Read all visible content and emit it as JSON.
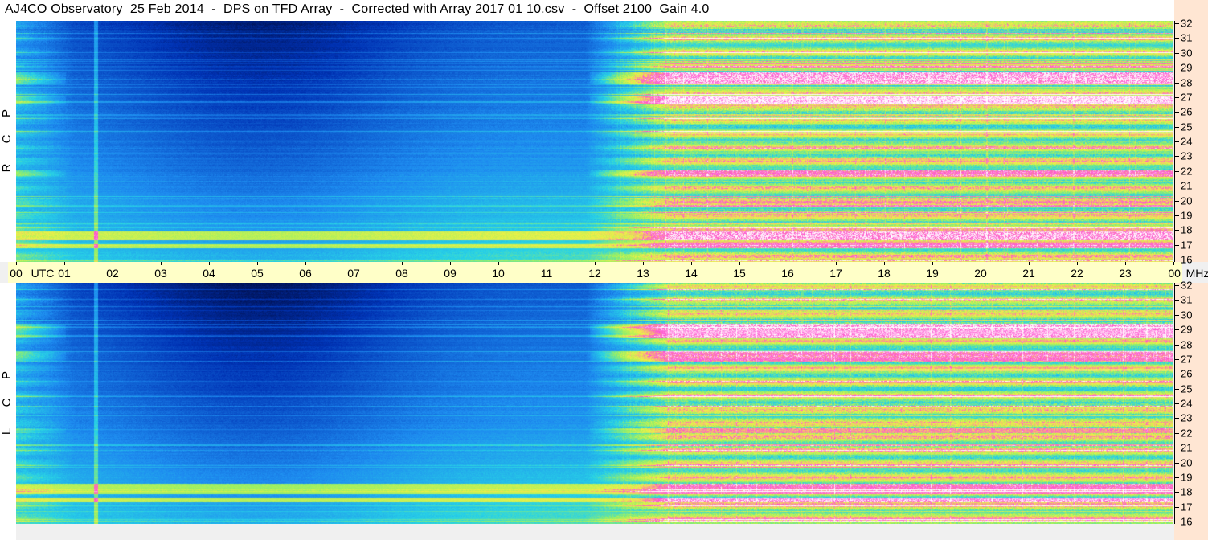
{
  "title": "AJ4CO Observatory  25 Feb 2014  -  DPS on TFD Array  -  Corrected with Array 2017 01 10.csv  -  Offset 2100  Gain 4.0",
  "axis_units": {
    "time": "UTC",
    "freq": "MHz"
  },
  "time_ticks": [
    "00",
    "01",
    "02",
    "03",
    "04",
    "05",
    "06",
    "07",
    "08",
    "09",
    "10",
    "11",
    "12",
    "13",
    "14",
    "15",
    "16",
    "17",
    "18",
    "19",
    "20",
    "21",
    "22",
    "23",
    "00"
  ],
  "freq_ticks": [
    "32",
    "31",
    "30",
    "29",
    "28",
    "27",
    "26",
    "25",
    "24",
    "23",
    "22",
    "21",
    "20",
    "19",
    "18",
    "17",
    "16"
  ],
  "panels": [
    {
      "polarization": [
        "R",
        "C",
        "P"
      ]
    },
    {
      "polarization": [
        "L",
        "C",
        "P"
      ]
    }
  ],
  "chart_data": {
    "type": "heatmap",
    "title": "AJ4CO Observatory  25 Feb 2014  -  DPS on TFD Array  -  Corrected with Array 2017 01 10.csv  -  Offset 2100  Gain 4.0",
    "xlabel": "UTC",
    "ylabel": "MHz",
    "x_range_hours": [
      0,
      24
    ],
    "y_range_mhz": [
      16,
      32
    ],
    "panels": [
      {
        "polarization": "RCP"
      },
      {
        "polarization": "LCP"
      }
    ],
    "colormap": [
      "#000a3c",
      "#0032b4",
      "#1e8cf0",
      "#28d2e6",
      "#9af064",
      "#f0f046",
      "#ff50d2",
      "#ffffff"
    ],
    "grid": false
  }
}
